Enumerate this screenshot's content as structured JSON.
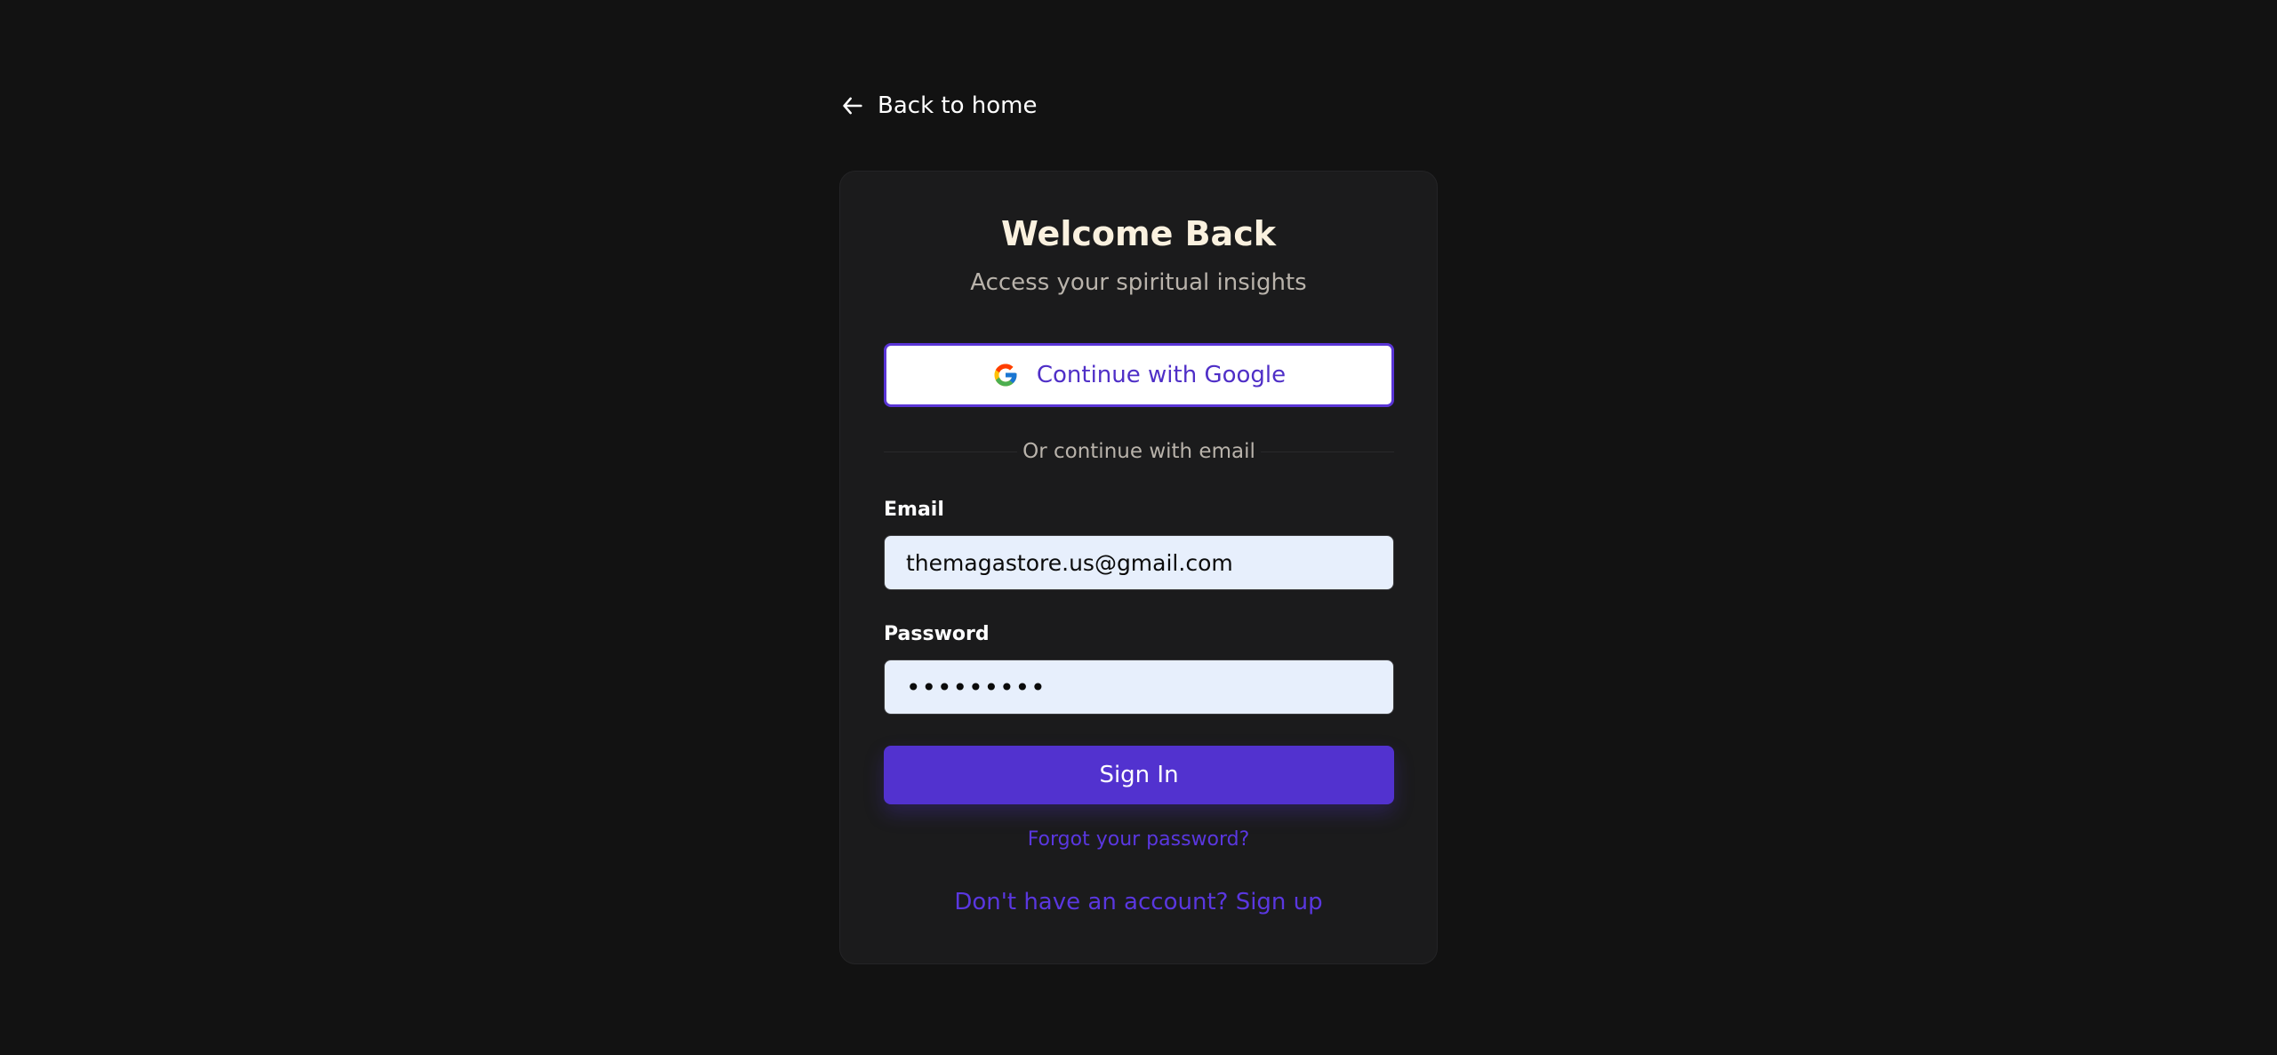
{
  "back_link": {
    "label": "Back to home",
    "icon": "arrow-left-icon"
  },
  "card": {
    "title": "Welcome Back",
    "subtitle": "Access your spiritual insights",
    "google_button": {
      "label": "Continue with Google",
      "icon": "google-logo-icon"
    },
    "divider_text": "Or continue with email",
    "email": {
      "label": "Email",
      "value": "themagastore.us@gmail.com"
    },
    "password": {
      "label": "Password",
      "value": "•••••••••"
    },
    "signin_button": "Sign In",
    "forgot_link": "Forgot your password?",
    "signup_link": "Don't have an account? Sign up"
  },
  "colors": {
    "background": "#121212",
    "card": "#1b1b1c",
    "accent": "#5232cf",
    "link": "#5a37e0",
    "title": "#faf1df",
    "input_bg": "#e7effc"
  }
}
